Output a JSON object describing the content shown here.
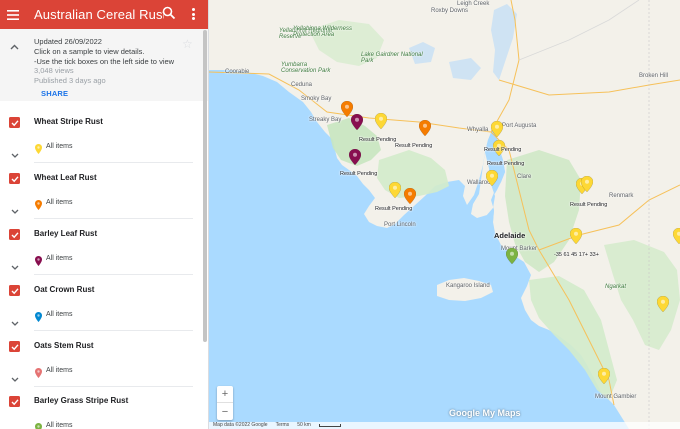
{
  "header": {
    "title": "Australian Cereal Rust Sur...",
    "menu_icon": "hamburger-menu-icon",
    "search_icon": "search-icon",
    "more_icon": "more-vert-icon",
    "accent": "#db4437"
  },
  "info": {
    "updated": "Updated 26/09/2022",
    "line1": "Click on a sample to view details.",
    "line2": "-Use the tick boxes on the left side to view",
    "views": "3,048 views",
    "published": "Published 3 days ago",
    "share": "SHARE"
  },
  "layers": [
    {
      "name": "Wheat Stripe Rust",
      "items": "All items",
      "color": "#fdd835"
    },
    {
      "name": "Wheat Leaf Rust",
      "items": "All items",
      "color": "#f57c00"
    },
    {
      "name": "Barley Leaf Rust",
      "items": "All items",
      "color": "#880e4f"
    },
    {
      "name": "Oat Crown Rust",
      "items": "All items",
      "color": "#0288d1"
    },
    {
      "name": "Oats Stem Rust",
      "items": "All items",
      "color": "#e57373"
    },
    {
      "name": "Barley Grass Stripe Rust",
      "items": "All items",
      "color": "#7cb342"
    }
  ],
  "map": {
    "places": {
      "leigh_creek": "Leigh Creek",
      "roxby_downs": "Roxby Downs",
      "yellabinna": "Yellabinna Regional Reserve",
      "yellabinna_wild": "Yellabinna Wilderness Protection Area",
      "lake_gairdner": "Lake Gairdner National Park",
      "yumbarra": "Yumbarra Conservation Park",
      "coorabie": "Coorabie",
      "ceduna": "Ceduna",
      "smoky_bay": "Smoky Bay",
      "streaky_bay": "Streaky Bay",
      "whyalla": "Whyalla",
      "port_augusta": "Port Augusta",
      "wallaroo": "Wallaroo",
      "clare": "Clare",
      "port_lincoln": "Port Lincoln",
      "adelaide": "Adelaide",
      "mount_barker": "Mount Barker",
      "kangaroo_island": "Kangaroo Island",
      "renmark": "Renmark",
      "broken_hill": "Broken Hill",
      "ngarkat": "Ngarkat",
      "mount_gambier": "Mount Gambier"
    },
    "result_label": "Result Pending",
    "coord_label": "-35 61 45 17+ 33+",
    "logo": "Google My Maps",
    "attribution": "Map data ©2022 Google",
    "terms": "Terms",
    "scale": "50 km",
    "zoom_in": "+",
    "zoom_out": "−"
  }
}
